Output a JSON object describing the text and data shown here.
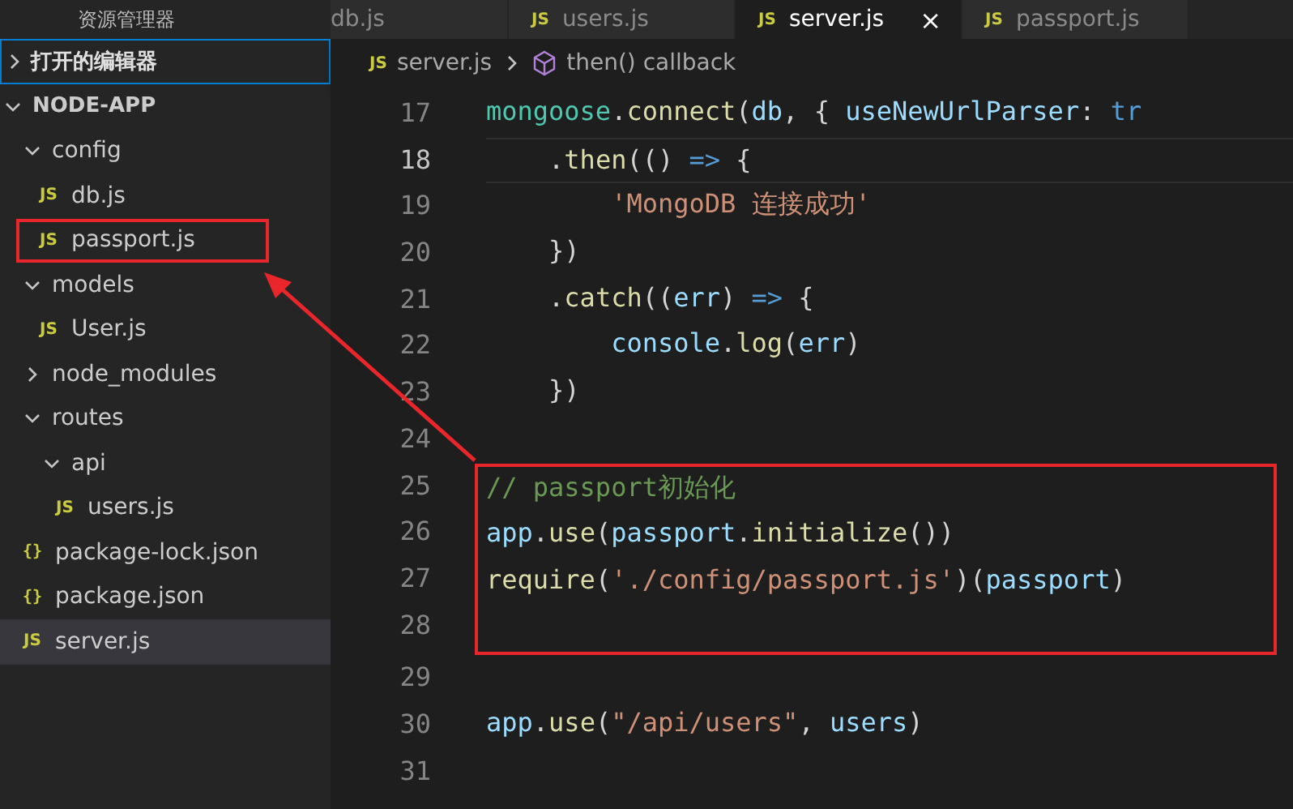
{
  "sidebar": {
    "title": "资源管理器",
    "open_editors": {
      "label": "打开的编辑器",
      "expanded": false,
      "focused": true
    },
    "tree": [
      {
        "label": "NODE-APP",
        "kind": "root",
        "expanded": true,
        "selected": false,
        "annotated": false,
        "children": [
          {
            "label": "config",
            "kind": "folder",
            "expanded": true,
            "selected": false,
            "annotated": false,
            "children": [
              {
                "label": "db.js",
                "kind": "file",
                "icon": "JS",
                "selected": false,
                "annotated": false
              },
              {
                "label": "passport.js",
                "kind": "file",
                "icon": "JS",
                "selected": false,
                "annotated": true
              }
            ]
          },
          {
            "label": "models",
            "kind": "folder",
            "expanded": true,
            "selected": false,
            "annotated": false,
            "children": [
              {
                "label": "User.js",
                "kind": "file",
                "icon": "JS",
                "selected": false,
                "annotated": false
              }
            ]
          },
          {
            "label": "node_modules",
            "kind": "folder",
            "expanded": false,
            "selected": false,
            "annotated": false
          },
          {
            "label": "routes",
            "kind": "folder",
            "expanded": true,
            "selected": false,
            "annotated": false,
            "children": [
              {
                "label": "api",
                "kind": "folder",
                "expanded": true,
                "selected": false,
                "annotated": false,
                "children": [
                  {
                    "label": "users.js",
                    "kind": "file",
                    "icon": "JS",
                    "selected": false,
                    "annotated": false
                  }
                ]
              }
            ]
          },
          {
            "label": "package-lock.json",
            "kind": "file",
            "icon": "{}",
            "selected": false,
            "annotated": false
          },
          {
            "label": "package.json",
            "kind": "file",
            "icon": "{}",
            "selected": false,
            "annotated": false
          },
          {
            "label": "server.js",
            "kind": "file",
            "icon": "JS",
            "selected": true,
            "annotated": false
          }
        ]
      }
    ]
  },
  "tabs": [
    {
      "label": "db.js",
      "selected": false
    },
    {
      "label": "users.js",
      "icon": "JS",
      "selected": false
    },
    {
      "label": "server.js",
      "icon": "JS",
      "selected": true,
      "close": "×"
    },
    {
      "label": "passport.js",
      "icon": "JS",
      "selected": false
    }
  ],
  "breadcrumb": {
    "file_icon": "JS",
    "file": "server.js",
    "symbol": "then() callback"
  },
  "editor": {
    "lines": [
      {
        "number": "17",
        "current": false,
        "tokens": [
          {
            "t": "mongoose",
            "kind": "type"
          },
          {
            "t": ".",
            "kind": "plain"
          },
          {
            "t": "connect",
            "kind": "func"
          },
          {
            "t": "(",
            "kind": "plain"
          },
          {
            "t": "db",
            "kind": "var"
          },
          {
            "t": ", { ",
            "kind": "plain"
          },
          {
            "t": "useNewUrlParser",
            "kind": "var"
          },
          {
            "t": ": ",
            "kind": "plain"
          },
          {
            "t": "tr",
            "kind": "keyword"
          }
        ]
      },
      {
        "number": "18",
        "current": true,
        "tokens": [
          {
            "t": "    .",
            "kind": "plain"
          },
          {
            "t": "then",
            "kind": "func"
          },
          {
            "t": "(() ",
            "kind": "plain"
          },
          {
            "t": "=>",
            "kind": "keyword"
          },
          {
            "t": " {",
            "kind": "plain"
          }
        ]
      },
      {
        "number": "19",
        "current": false,
        "tokens": [
          {
            "t": "        'MongoDB 连接成功'",
            "kind": "string"
          }
        ]
      },
      {
        "number": "20",
        "current": false,
        "tokens": [
          {
            "t": "    })",
            "kind": "plain"
          }
        ]
      },
      {
        "number": "21",
        "current": false,
        "tokens": [
          {
            "t": "    .",
            "kind": "plain"
          },
          {
            "t": "catch",
            "kind": "func"
          },
          {
            "t": "((",
            "kind": "plain"
          },
          {
            "t": "err",
            "kind": "var"
          },
          {
            "t": ") ",
            "kind": "plain"
          },
          {
            "t": "=>",
            "kind": "keyword"
          },
          {
            "t": " {",
            "kind": "plain"
          }
        ]
      },
      {
        "number": "22",
        "current": false,
        "tokens": [
          {
            "t": "        console",
            "kind": "var"
          },
          {
            "t": ".",
            "kind": "plain"
          },
          {
            "t": "log",
            "kind": "func"
          },
          {
            "t": "(",
            "kind": "plain"
          },
          {
            "t": "err",
            "kind": "var"
          },
          {
            "t": ")",
            "kind": "plain"
          }
        ]
      },
      {
        "number": "23",
        "current": false,
        "tokens": [
          {
            "t": "    })",
            "kind": "plain"
          }
        ]
      },
      {
        "number": "24",
        "current": false
      },
      {
        "number": "25",
        "current": false,
        "annotated": true,
        "tokens": [
          {
            "t": "// passport初始化",
            "kind": "comment"
          }
        ]
      },
      {
        "number": "26",
        "current": false,
        "annotated": true,
        "tokens": [
          {
            "t": "app",
            "kind": "var"
          },
          {
            "t": ".",
            "kind": "plain"
          },
          {
            "t": "use",
            "kind": "func"
          },
          {
            "t": "(",
            "kind": "plain"
          },
          {
            "t": "passport",
            "kind": "var"
          },
          {
            "t": ".",
            "kind": "plain"
          },
          {
            "t": "initialize",
            "kind": "func"
          },
          {
            "t": "())",
            "kind": "plain"
          }
        ]
      },
      {
        "number": "27",
        "current": false,
        "annotated": true,
        "tokens": [
          {
            "t": "require",
            "kind": "func"
          },
          {
            "t": "(",
            "kind": "plain"
          },
          {
            "t": "'./config/passport.js'",
            "kind": "string"
          },
          {
            "t": ")(",
            "kind": "plain"
          },
          {
            "t": "passport",
            "kind": "var"
          },
          {
            "t": ")",
            "kind": "plain"
          }
        ]
      },
      {
        "number": "28",
        "current": false,
        "annotated": true
      },
      {
        "number": "29",
        "current": false
      },
      {
        "number": "30",
        "current": false,
        "tokens": [
          {
            "t": "app",
            "kind": "var"
          },
          {
            "t": ".",
            "kind": "plain"
          },
          {
            "t": "use",
            "kind": "func"
          },
          {
            "t": "(",
            "kind": "plain"
          },
          {
            "t": "\"/api/users\"",
            "kind": "string"
          },
          {
            "t": ", ",
            "kind": "plain"
          },
          {
            "t": "users",
            "kind": "var"
          },
          {
            "t": ")",
            "kind": "plain"
          }
        ]
      },
      {
        "number": "31",
        "current": false
      }
    ]
  }
}
